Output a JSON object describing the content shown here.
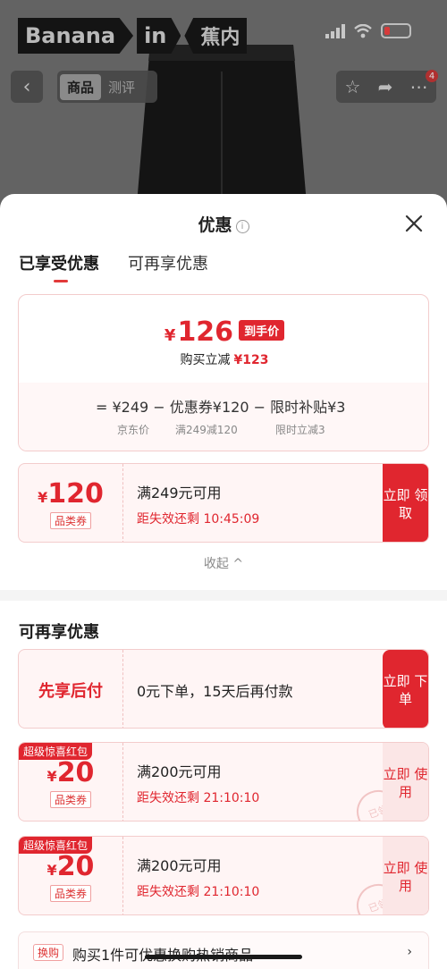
{
  "background": {
    "brand": {
      "part1": "Banana",
      "part2": "in",
      "part3": "蕉内"
    },
    "tabs": {
      "product": "商品",
      "review": "测评"
    },
    "badge_count": "4"
  },
  "sheet": {
    "title": "优惠",
    "tabs": {
      "enjoyed": "已享受优惠",
      "more": "可再享优惠"
    },
    "summary": {
      "currency": "¥",
      "final_price": "126",
      "final_tag": "到手价",
      "reduce_label": "购买立减",
      "reduce_amount": "¥123",
      "formula_text": "= ¥249 − 优惠券¥120 − 限时补贴¥3",
      "sub_jd": "京东价",
      "sub_coupon": "满249减120",
      "sub_subsidy": "限时立减3"
    },
    "coupon_main": {
      "currency": "¥",
      "amount": "120",
      "category": "品类券",
      "condition": "满249元可用",
      "timer": "距失效还剩 10:45:09",
      "button": "立即 领取"
    },
    "collapse_label": "收起 ^",
    "more_section_title": "可再享优惠",
    "paylater": {
      "title": "先享后付",
      "desc": "0元下单，15天后再付款",
      "button": "立即 下单"
    },
    "red_packets": [
      {
        "corner": "超级惊喜红包",
        "currency": "¥",
        "amount": "20",
        "category": "品类券",
        "condition": "满200元可用",
        "timer": "距失效还剩 21:10:10",
        "button": "立即 使用",
        "stamp": "已领"
      },
      {
        "corner": "超级惊喜红包",
        "currency": "¥",
        "amount": "20",
        "category": "品类券",
        "condition": "满200元可用",
        "timer": "距失效还剩 21:10:10",
        "button": "立即 使用",
        "stamp": "已领"
      }
    ],
    "exchange": {
      "tag": "换购",
      "text": "购买1件可优惠换购热销商品",
      "chevron": "›"
    }
  },
  "colors": {
    "accent": "#e0262f",
    "light_bg": "#fff5f5"
  },
  "icons": [
    "back-icon",
    "signal-icon",
    "wifi-icon",
    "battery-icon",
    "star-icon",
    "share-icon",
    "more-icon",
    "info-icon",
    "close-icon",
    "chevron-right-icon"
  ]
}
